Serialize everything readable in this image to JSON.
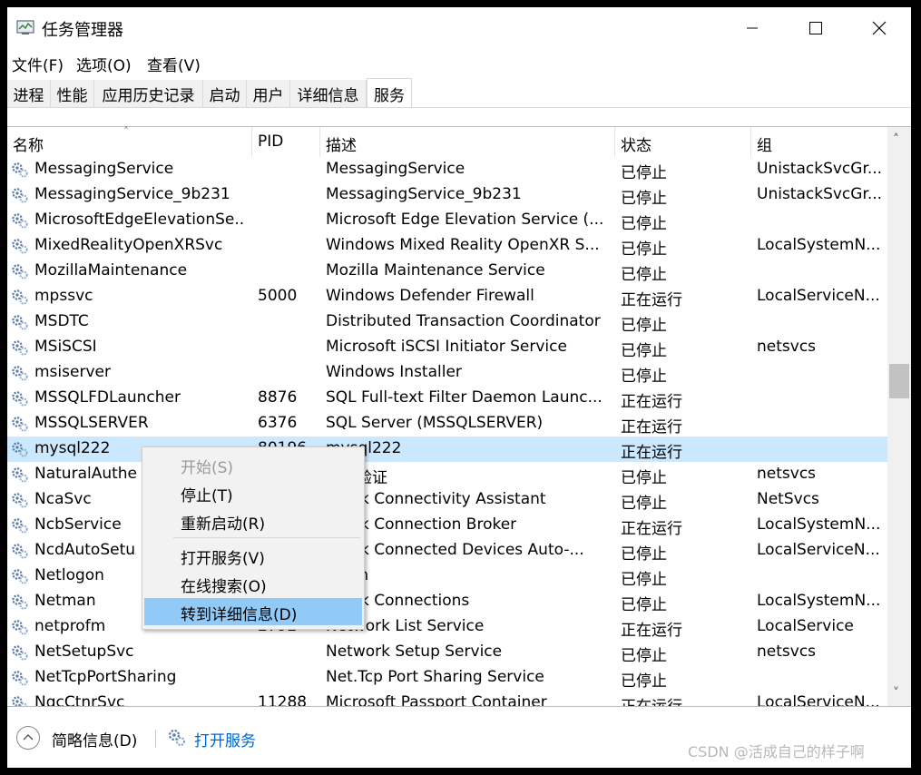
{
  "window": {
    "title": "任务管理器"
  },
  "menu": [
    "文件(F)",
    "选项(O)",
    "查看(V)"
  ],
  "tabs": [
    "进程",
    "性能",
    "应用历史记录",
    "启动",
    "用户",
    "详细信息",
    "服务"
  ],
  "active_tab": "服务",
  "columns": {
    "name": "名称",
    "pid": "PID",
    "desc": "描述",
    "status": "状态",
    "group": "组"
  },
  "rows": [
    {
      "name": "MessagingService",
      "pid": "",
      "desc": "MessagingService",
      "status": "已停止",
      "group": "UnistackSvcGr..."
    },
    {
      "name": "MessagingService_9b231",
      "pid": "",
      "desc": "MessagingService_9b231",
      "status": "已停止",
      "group": "UnistackSvcGr..."
    },
    {
      "name": "MicrosoftEdgeElevationSe...",
      "pid": "",
      "desc": "Microsoft Edge Elevation Service (...",
      "status": "已停止",
      "group": ""
    },
    {
      "name": "MixedRealityOpenXRSvc",
      "pid": "",
      "desc": "Windows Mixed Reality OpenXR S...",
      "status": "已停止",
      "group": "LocalSystemN..."
    },
    {
      "name": "MozillaMaintenance",
      "pid": "",
      "desc": "Mozilla Maintenance Service",
      "status": "已停止",
      "group": ""
    },
    {
      "name": "mpssvc",
      "pid": "5000",
      "desc": "Windows Defender Firewall",
      "status": "正在运行",
      "group": "LocalServiceN..."
    },
    {
      "name": "MSDTC",
      "pid": "",
      "desc": "Distributed Transaction Coordinator",
      "status": "已停止",
      "group": ""
    },
    {
      "name": "MSiSCSI",
      "pid": "",
      "desc": "Microsoft iSCSI Initiator Service",
      "status": "已停止",
      "group": "netsvcs"
    },
    {
      "name": "msiserver",
      "pid": "",
      "desc": "Windows Installer",
      "status": "已停止",
      "group": ""
    },
    {
      "name": "MSSQLFDLauncher",
      "pid": "8876",
      "desc": "SQL Full-text Filter Daemon Launc...",
      "status": "正在运行",
      "group": ""
    },
    {
      "name": "MSSQLSERVER",
      "pid": "6376",
      "desc": "SQL Server (MSSQLSERVER)",
      "status": "正在运行",
      "group": ""
    },
    {
      "name": "mysql222",
      "pid": "80196",
      "desc": "mysql222",
      "status": "正在运行",
      "group": "",
      "selected": true
    },
    {
      "name": "NaturalAuthe",
      "pid": "",
      "desc": "身份验证",
      "status": "已停止",
      "group": "netsvcs"
    },
    {
      "name": "NcaSvc",
      "pid": "",
      "desc": "twork Connectivity Assistant",
      "status": "已停止",
      "group": "NetSvcs"
    },
    {
      "name": "NcbService",
      "pid": "",
      "desc": "twork Connection Broker",
      "status": "正在运行",
      "group": "LocalSystemN..."
    },
    {
      "name": "NcdAutoSetu",
      "pid": "",
      "desc": "twork Connected Devices Auto-...",
      "status": "已停止",
      "group": "LocalServiceN..."
    },
    {
      "name": "Netlogon",
      "pid": "",
      "desc": "logon",
      "status": "已停止",
      "group": ""
    },
    {
      "name": "Netman",
      "pid": "",
      "desc": "twork Connections",
      "status": "已停止",
      "group": "LocalSystemN..."
    },
    {
      "name": "netprofm",
      "pid": "2792",
      "desc": "Network List Service",
      "status": "正在运行",
      "group": "LocalService"
    },
    {
      "name": "NetSetupSvc",
      "pid": "",
      "desc": "Network Setup Service",
      "status": "已停止",
      "group": "netsvcs"
    },
    {
      "name": "NetTcpPortSharing",
      "pid": "",
      "desc": "Net.Tcp Port Sharing Service",
      "status": "已停止",
      "group": ""
    },
    {
      "name": "NgcCtnrSvc",
      "pid": "11288",
      "desc": "Microsoft Passport Container",
      "status": "正在运行",
      "group": "LocalServiceN..."
    }
  ],
  "context_menu": [
    {
      "label": "开始(S)",
      "disabled": true
    },
    {
      "label": "停止(T)"
    },
    {
      "label": "重新启动(R)"
    },
    {
      "label": "打开服务(V)"
    },
    {
      "label": "在线搜索(O)"
    },
    {
      "label": "转到详细信息(D)",
      "highlighted": true
    }
  ],
  "footer": {
    "less_details": "简略信息(D)",
    "open_services": "打开服务"
  },
  "watermark": "CSDN @活成自己的样子啊",
  "colors": {
    "selection": "#cce8ff",
    "menu_highlight": "#91c9f7",
    "link": "#0066cc"
  }
}
